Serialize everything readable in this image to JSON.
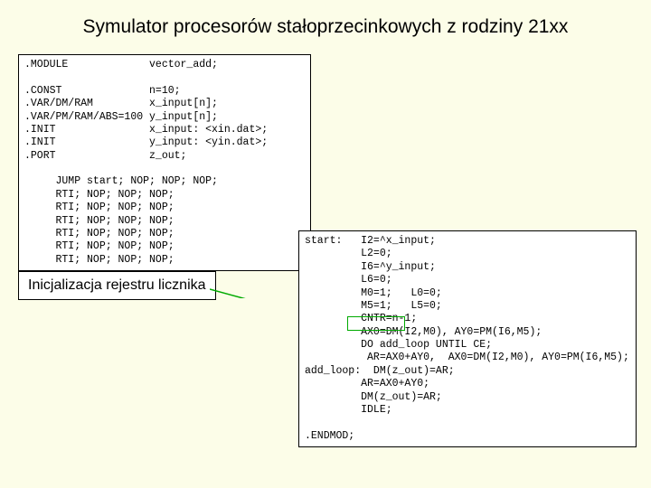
{
  "title": "Symulator procesorów stałoprzecinkowych z rodziny 21xx",
  "callout": "Inicjalizacja rejestru licznika",
  "code_box_1": ".MODULE             vector_add;\n\n.CONST              n=10;\n.VAR/DM/RAM         x_input[n];\n.VAR/PM/RAM/ABS=100 y_input[n];\n.INIT               x_input: <xin.dat>;\n.INIT               y_input: <yin.dat>;\n.PORT               z_out;\n\n     JUMP start; NOP; NOP; NOP;\n     RTI; NOP; NOP; NOP;\n     RTI; NOP; NOP; NOP;\n     RTI; NOP; NOP; NOP;\n     RTI; NOP; NOP; NOP;\n     RTI; NOP; NOP; NOP;\n     RTI; NOP; NOP; NOP;",
  "code_box_2": "start:   I2=^x_input;\n         L2=0;\n         I6=^y_input;\n         L6=0;\n         M0=1;   L0=0;\n         M5=1;   L5=0;\n         CNTR=n-1;\n         AX0=DM(I2,M0), AY0=PM(I6,M5);\n         DO add_loop UNTIL CE;\n          AR=AX0+AY0,  AX0=DM(I2,M0), AY0=PM(I6,M5);\nadd_loop:  DM(z_out)=AR;\n         AR=AX0+AY0;\n         DM(z_out)=AR;\n         IDLE;\n\n.ENDMOD;"
}
